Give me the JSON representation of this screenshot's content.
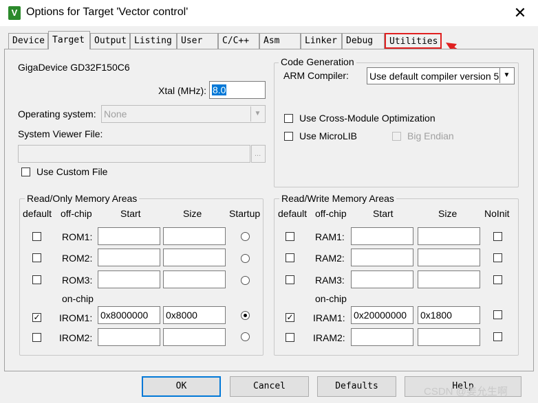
{
  "window": {
    "title": "Options for Target 'Vector control'",
    "app_icon": "V",
    "close_glyph": "✕"
  },
  "tabs": [
    {
      "label": "Device"
    },
    {
      "label": "Target",
      "active": true
    },
    {
      "label": "Output"
    },
    {
      "label": "Listing"
    },
    {
      "label": "User"
    },
    {
      "label": "C/C++"
    },
    {
      "label": "Asm"
    },
    {
      "label": "Linker"
    },
    {
      "label": "Debug"
    },
    {
      "label": "Utilities",
      "highlighted": true
    }
  ],
  "annotation": {
    "arrow_color": "#e02020"
  },
  "target": {
    "device_name": "GigaDevice GD32F150C6",
    "xtal_label": "Xtal (MHz):",
    "xtal_value": "8.0",
    "os_label": "Operating system:",
    "os_value": "None",
    "svf_label": "System Viewer File:",
    "svf_value": "",
    "svf_browse": "...",
    "custom_file_label": "Use Custom File",
    "custom_file_checked": false
  },
  "code_generation": {
    "title": "Code Generation",
    "arm_compiler_label": "ARM Compiler:",
    "arm_compiler_value": "Use default compiler version 5",
    "cross_module_label": "Use Cross-Module Optimization",
    "microlib_label": "Use MicroLIB",
    "big_endian_label": "Big Endian"
  },
  "ro_memory": {
    "title": "Read/Only Memory Areas",
    "headers": {
      "default": "default",
      "offchip": "off-chip",
      "start": "Start",
      "size": "Size",
      "startup": "Startup"
    },
    "onchip_label": "on-chip",
    "rows": [
      {
        "name": "ROM1:",
        "start": "",
        "size": "",
        "default": false,
        "startup": false
      },
      {
        "name": "ROM2:",
        "start": "",
        "size": "",
        "default": false,
        "startup": false
      },
      {
        "name": "ROM3:",
        "start": "",
        "size": "",
        "default": false,
        "startup": false
      },
      {
        "name": "IROM1:",
        "start": "0x8000000",
        "size": "0x8000",
        "default": true,
        "startup": true
      },
      {
        "name": "IROM2:",
        "start": "",
        "size": "",
        "default": false,
        "startup": false
      }
    ]
  },
  "rw_memory": {
    "title": "Read/Write Memory Areas",
    "headers": {
      "default": "default",
      "offchip": "off-chip",
      "start": "Start",
      "size": "Size",
      "noinit": "NoInit"
    },
    "onchip_label": "on-chip",
    "rows": [
      {
        "name": "RAM1:",
        "start": "",
        "size": "",
        "default": false,
        "noinit": false
      },
      {
        "name": "RAM2:",
        "start": "",
        "size": "",
        "default": false,
        "noinit": false
      },
      {
        "name": "RAM3:",
        "start": "",
        "size": "",
        "default": false,
        "noinit": false
      },
      {
        "name": "IRAM1:",
        "start": "0x20000000",
        "size": "0x1800",
        "default": true,
        "noinit": false
      },
      {
        "name": "IRAM2:",
        "start": "",
        "size": "",
        "default": false,
        "noinit": false
      }
    ]
  },
  "buttons": {
    "ok": "OK",
    "cancel": "Cancel",
    "defaults": "Defaults",
    "help": "Help"
  },
  "watermark": "CSDN @姜允生啊",
  "check_glyph": "✓"
}
